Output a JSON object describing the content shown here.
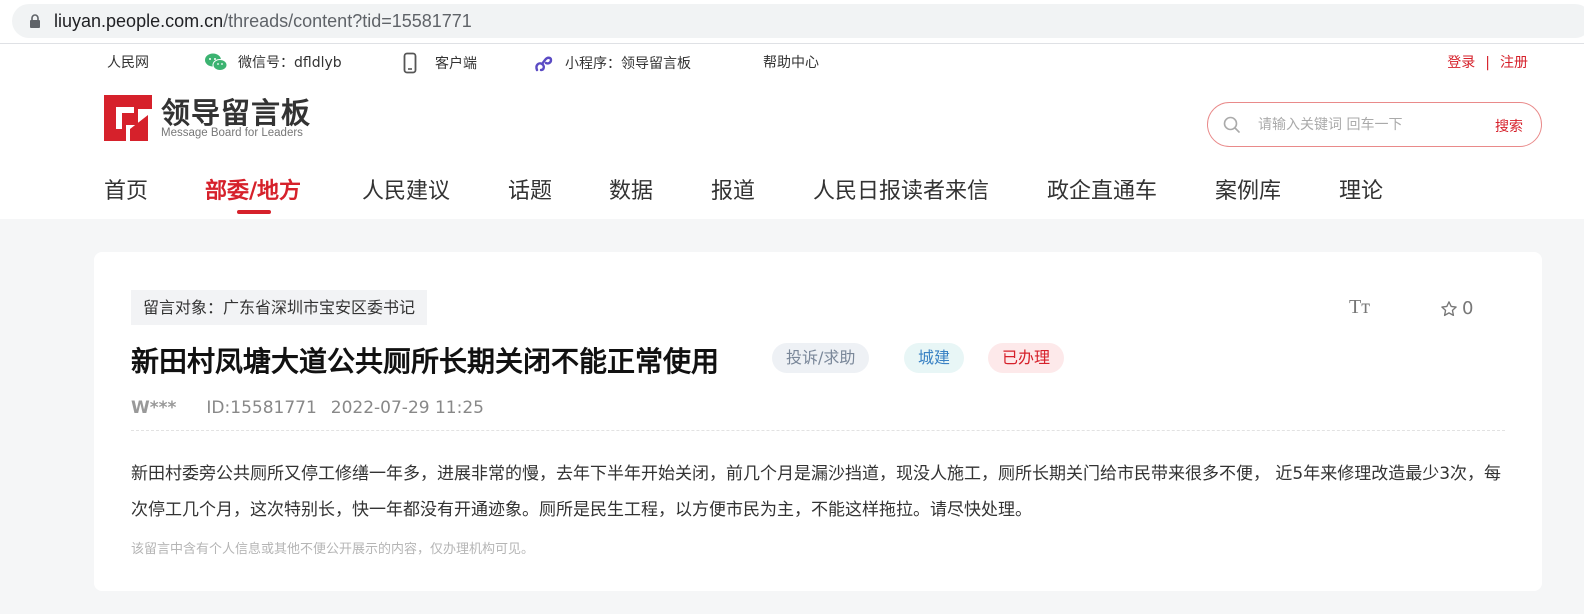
{
  "browser": {
    "url_host": "liuyan.people.com.cn",
    "url_path": "/threads/content?tid=15581771"
  },
  "topbar": {
    "people_net": "人民网",
    "wechat": "微信号：dfldlyb",
    "client": "客户端",
    "miniprogram": "小程序：领导留言板",
    "help": "帮助中心",
    "login": "登录",
    "separator": "|",
    "register": "注册"
  },
  "logo": {
    "cn": "领导留言板",
    "en": "Message Board for Leaders"
  },
  "search": {
    "placeholder": "请输入关键词 回车一下",
    "button": "搜索"
  },
  "nav": {
    "items": [
      "首页",
      "部委/地方",
      "人民建议",
      "话题",
      "数据",
      "报道",
      "人民日报读者来信",
      "政企直通车",
      "案例库",
      "理论"
    ],
    "active_index": 1
  },
  "message": {
    "target": "留言对象：广东省深圳市宝安区委书记",
    "font_toggle": "Tт",
    "favorite_count": "0",
    "title": "新田村凤塘大道公共厕所长期关闭不能正常使用",
    "tags": [
      "投诉/求助",
      "城建",
      "已办理"
    ],
    "author": "W***",
    "id": "ID:15581771",
    "datetime": "2022-07-29 11:25",
    "content": "新田村委旁公共厕所又停工修缮一年多，进展非常的慢，去年下半年开始关闭，前几个月是漏沙挡道，现没人施工，厕所长期关门给市民带来很多不便， 近5年来修理改造最少3次，每次停工几个月，这次特别长，快一年都没有开通迹象。厕所是民生工程，以方便市民为主，不能这样拖拉。请尽快处理。",
    "privacy_notice": "该留言中含有个人信息或其他不便公开展示的内容，仅办理机构可见。"
  },
  "colors": {
    "brand_red": "#d6212b",
    "page_bg": "#f5f6f7"
  }
}
